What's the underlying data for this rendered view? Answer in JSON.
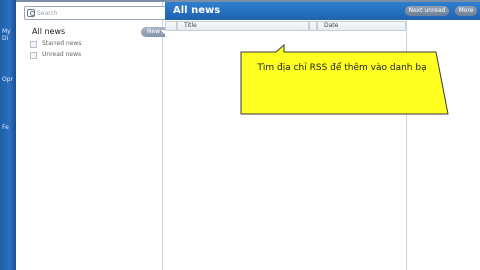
{
  "app_strip": {
    "labels": [
      "My",
      "Di",
      "Opr",
      "Fe"
    ]
  },
  "sidebar": {
    "search": {
      "placeholder": "Search"
    },
    "all_news_label": "All news",
    "new_button_label": "New",
    "items": [
      {
        "label": "Starred news"
      },
      {
        "label": "Unread news"
      }
    ]
  },
  "main": {
    "title": "All news",
    "next_unread_label": "Next unread",
    "more_label": "More",
    "columns": [
      {
        "label": ""
      },
      {
        "label": "Title"
      },
      {
        "label": ""
      },
      {
        "label": "Date"
      }
    ]
  },
  "callout": {
    "text": "Tìm địa chỉ RSS để thêm vào danh bạ"
  },
  "colors": {
    "accent_blue": "#2f7fd1",
    "callout_yellow": "#ffff22"
  }
}
